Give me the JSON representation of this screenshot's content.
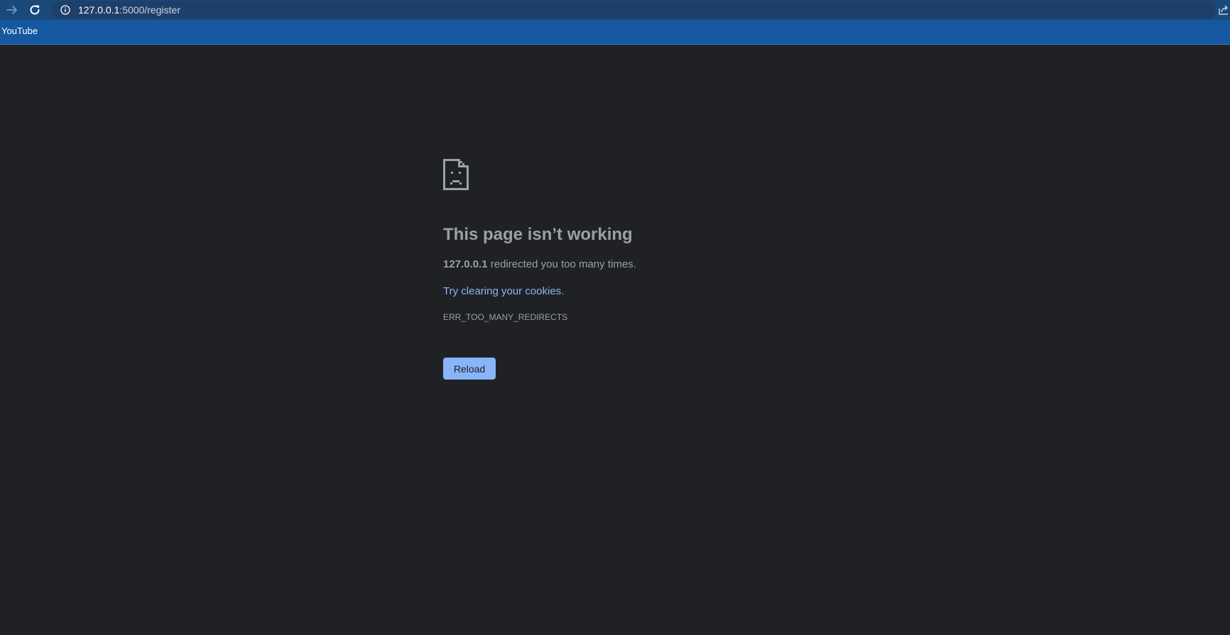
{
  "browser": {
    "url_host": "127.0.0.1",
    "url_rest": ":5000/register",
    "bookmarks": [
      {
        "label": "YouTube"
      }
    ]
  },
  "error_page": {
    "title": "This page isn’t working",
    "summary_host": "127.0.0.1",
    "summary_rest": " redirected you too many times.",
    "suggestion": "Try clearing your cookies.",
    "error_code": "ERR_TOO_MANY_REDIRECTS",
    "reload_label": "Reload"
  },
  "colors": {
    "background": "#202124",
    "toolbar": "#1a4a7c",
    "bookmarks_bar": "#1557a0",
    "link": "#8ab4f8",
    "text": "#9aa0a6",
    "button": "#8ab4f8"
  },
  "icons": {
    "forward": "forward-arrow-icon",
    "reload": "reload-icon",
    "info": "info-icon",
    "share": "share-icon",
    "error": "sad-page-icon"
  }
}
